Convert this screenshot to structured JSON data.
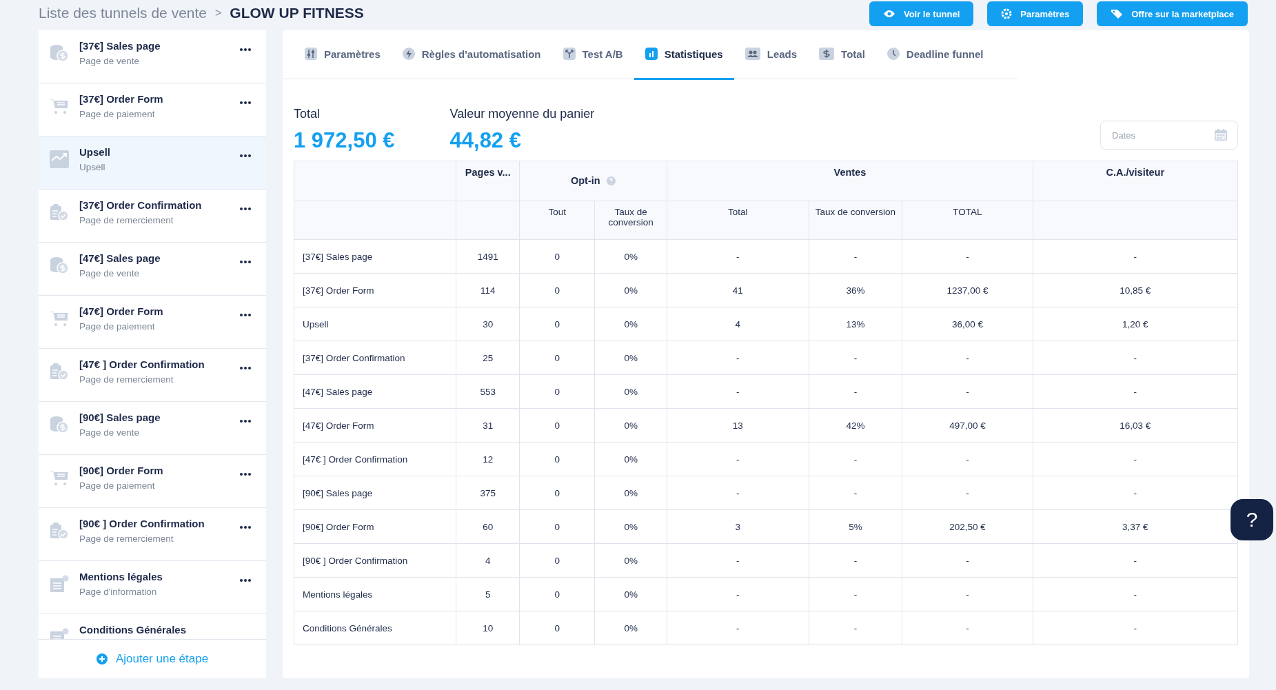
{
  "breadcrumb": {
    "parent": "Liste des tunnels de vente",
    "separator": ">",
    "current": "GLOW UP FITNESS"
  },
  "header_buttons": [
    {
      "label": "Voir le tunnel",
      "kind": "eye"
    },
    {
      "label": "Paramètres",
      "kind": "gear"
    },
    {
      "label": "Offre sur la marketplace",
      "kind": "tag"
    }
  ],
  "steps": [
    {
      "title": "[37€] Sales page",
      "subtitle": "Page de vente",
      "kind": "sales",
      "selected": false
    },
    {
      "title": "[37€] Order Form",
      "subtitle": "Page de paiement",
      "kind": "order",
      "selected": false
    },
    {
      "title": "Upsell",
      "subtitle": "Upsell",
      "kind": "upsell",
      "selected": true
    },
    {
      "title": "[37€] Order Confirmation",
      "subtitle": "Page de remerciement",
      "kind": "confirmation",
      "selected": false
    },
    {
      "title": "[47€] Sales page",
      "subtitle": "Page de vente",
      "kind": "sales",
      "selected": false
    },
    {
      "title": "[47€] Order Form",
      "subtitle": "Page de paiement",
      "kind": "order",
      "selected": false
    },
    {
      "title": "[47€ ] Order Confirmation",
      "subtitle": "Page de remerciement",
      "kind": "confirmation",
      "selected": false
    },
    {
      "title": "[90€] Sales page",
      "subtitle": "Page de vente",
      "kind": "sales",
      "selected": false
    },
    {
      "title": "[90€] Order Form",
      "subtitle": "Page de paiement",
      "kind": "order",
      "selected": false
    },
    {
      "title": "[90€ ] Order Confirmation",
      "subtitle": "Page de remerciement",
      "kind": "confirmation",
      "selected": false
    },
    {
      "title": "Mentions légales",
      "subtitle": "Page d'information",
      "kind": "legal",
      "selected": false
    },
    {
      "title": "Conditions Générales",
      "kind": "legal",
      "selected": false
    }
  ],
  "add_step_button": "Ajouter une étape",
  "tabs": [
    {
      "label": "Paramètres",
      "kind": "sliders",
      "selected": false
    },
    {
      "label": "Règles d'automatisation",
      "kind": "bolt",
      "selected": false
    },
    {
      "label": "Test A/B",
      "kind": "split",
      "selected": false
    },
    {
      "label": "Statistiques",
      "kind": "chart",
      "selected": true
    },
    {
      "label": "Leads",
      "kind": "people",
      "selected": false
    },
    {
      "label": "Total",
      "kind": "dollar",
      "selected": false
    },
    {
      "label": "Deadline funnel",
      "kind": "clock",
      "selected": false
    }
  ],
  "summary": [
    {
      "label": "Total",
      "value": "1 972,50 €"
    },
    {
      "label": "Valeur moyenne du panier",
      "value": "44,82 €"
    }
  ],
  "date_field": {
    "placeholder": "Dates"
  },
  "table": {
    "group_headers": [
      {
        "label": "Pages v..."
      },
      {
        "label": "Opt-in",
        "help": true
      },
      {
        "label": "Ventes"
      },
      {
        "label": "C.A./visiteur"
      }
    ],
    "columns": [
      "",
      "",
      "Tout",
      "Taux de conversion",
      "Total",
      "Taux de conversion",
      "TOTAL",
      ""
    ],
    "rows": [
      [
        "[37€] Sales page",
        "1491",
        "0",
        "0%",
        "-",
        "-",
        "-",
        "-"
      ],
      [
        "[37€] Order Form",
        "114",
        "0",
        "0%",
        "41",
        "36%",
        "1237,00 €",
        "10,85 €"
      ],
      [
        "Upsell",
        "30",
        "0",
        "0%",
        "4",
        "13%",
        "36,00 €",
        "1,20 €"
      ],
      [
        "[37€] Order Confirmation",
        "25",
        "0",
        "0%",
        "-",
        "-",
        "-",
        "-"
      ],
      [
        "[47€] Sales page",
        "553",
        "0",
        "0%",
        "-",
        "-",
        "-",
        "-"
      ],
      [
        "[47€] Order Form",
        "31",
        "0",
        "0%",
        "13",
        "42%",
        "497,00 €",
        "16,03 €"
      ],
      [
        "[47€ ] Order Confirmation",
        "12",
        "0",
        "0%",
        "-",
        "-",
        "-",
        "-"
      ],
      [
        "[90€] Sales page",
        "375",
        "0",
        "0%",
        "-",
        "-",
        "-",
        "-"
      ],
      [
        "[90€] Order Form",
        "60",
        "0",
        "0%",
        "3",
        "5%",
        "202,50 €",
        "3,37 €"
      ],
      [
        "[90€ ] Order Confirmation",
        "4",
        "0",
        "0%",
        "-",
        "-",
        "-",
        "-"
      ],
      [
        "Mentions légales",
        "5",
        "0",
        "0%",
        "-",
        "-",
        "-",
        "-"
      ],
      [
        "Conditions Générales",
        "10",
        "0",
        "0%",
        "-",
        "-",
        "-",
        "-"
      ]
    ]
  },
  "help_button": "?"
}
